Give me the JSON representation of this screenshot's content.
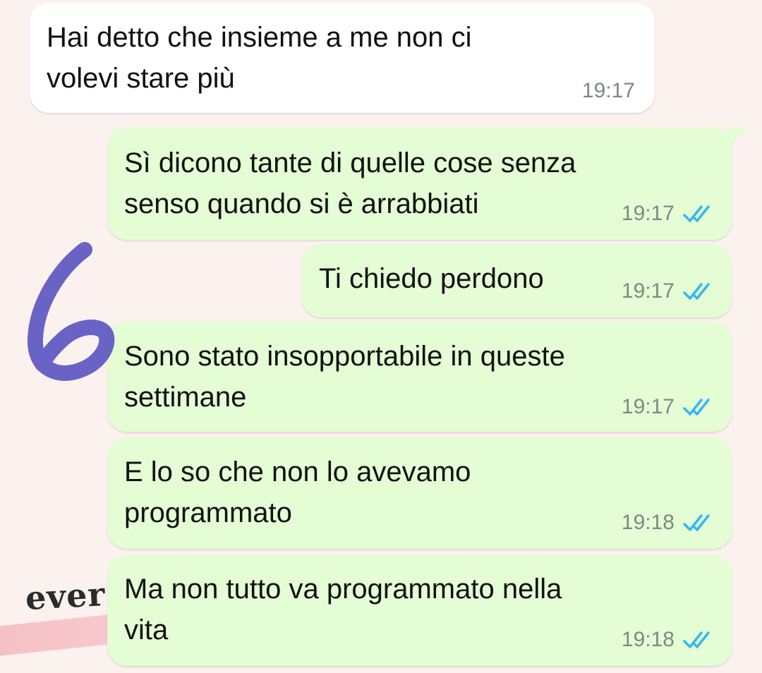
{
  "chat": {
    "messages": [
      {
        "direction": "in",
        "text": "Hai detto che insieme a me non ci\nvolevi stare più",
        "time": "19:17",
        "read": false
      },
      {
        "direction": "out",
        "text": "Sì dicono tante di quelle cose senza\nsenso quando si è arrabbiati",
        "time": "19:17",
        "read": true
      },
      {
        "direction": "out",
        "text": "Ti chiedo perdono",
        "time": "19:17",
        "read": true
      },
      {
        "direction": "out",
        "text": "Sono stato insopportabile in queste\nsettimane",
        "time": "19:17",
        "read": true
      },
      {
        "direction": "out",
        "text": "E lo so che non lo avevamo\nprogrammato",
        "time": "19:18",
        "read": true
      },
      {
        "direction": "out",
        "text": "Ma non tutto va programmato nella\nvita",
        "time": "19:18",
        "read": true
      }
    ]
  },
  "annotation": {
    "number": "6",
    "color": "#6a63c6"
  },
  "wallpaper": {
    "text": "ever"
  },
  "colors": {
    "incoming_bubble": "#ffffff",
    "outgoing_bubble": "#e4fdd4",
    "read_ticks": "#34b7f1",
    "timestamp": "#7d8a84",
    "background": "#fbf1ef"
  },
  "icons": {
    "read_receipt": "double-check-icon"
  }
}
